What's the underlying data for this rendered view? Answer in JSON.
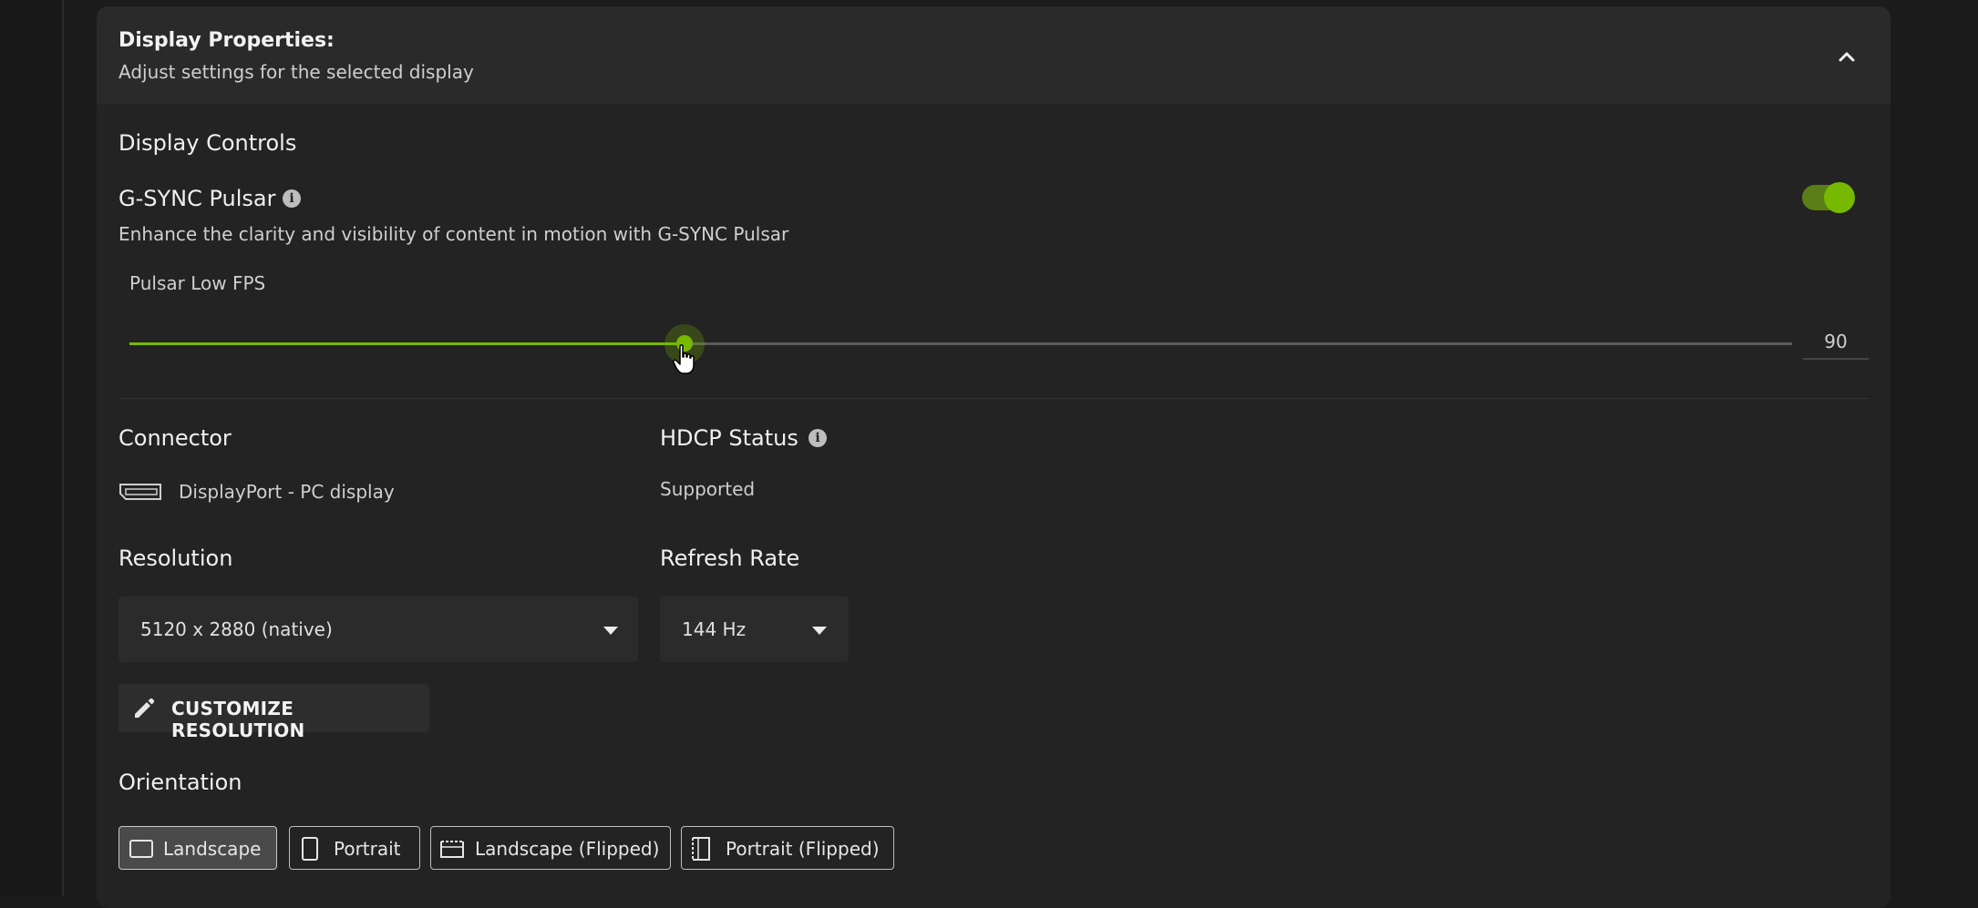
{
  "panel": {
    "title": "Display Properties:",
    "subtitle": "Adjust settings for the selected display"
  },
  "display_controls": {
    "heading": "Display Controls",
    "gsync": {
      "label": "G-SYNC Pulsar",
      "description": "Enhance the clarity and visibility of content in motion with G-SYNC Pulsar",
      "enabled": true
    },
    "pulsar_low_fps": {
      "label": "Pulsar Low FPS",
      "value": "90",
      "fill_fraction": 0.334
    }
  },
  "connector": {
    "label": "Connector",
    "value": "DisplayPort - PC display"
  },
  "hdcp": {
    "label": "HDCP Status",
    "value": "Supported"
  },
  "resolution": {
    "label": "Resolution",
    "selected": "5120 x 2880 (native)"
  },
  "refresh_rate": {
    "label": "Refresh Rate",
    "selected": "144 Hz"
  },
  "customize_button": {
    "label": "CUSTOMIZE RESOLUTION"
  },
  "orientation": {
    "label": "Orientation",
    "options": [
      {
        "label": "Landscape",
        "icon": "landscape-icon",
        "selected": true
      },
      {
        "label": "Portrait",
        "icon": "portrait-icon",
        "selected": false
      },
      {
        "label": "Landscape (Flipped)",
        "icon": "landscape-flipped-icon",
        "selected": false
      },
      {
        "label": "Portrait (Flipped)",
        "icon": "portrait-flipped-icon",
        "selected": false
      }
    ]
  },
  "colors": {
    "accent": "#76b900",
    "background": "#232323",
    "header": "#2a2a2a"
  }
}
